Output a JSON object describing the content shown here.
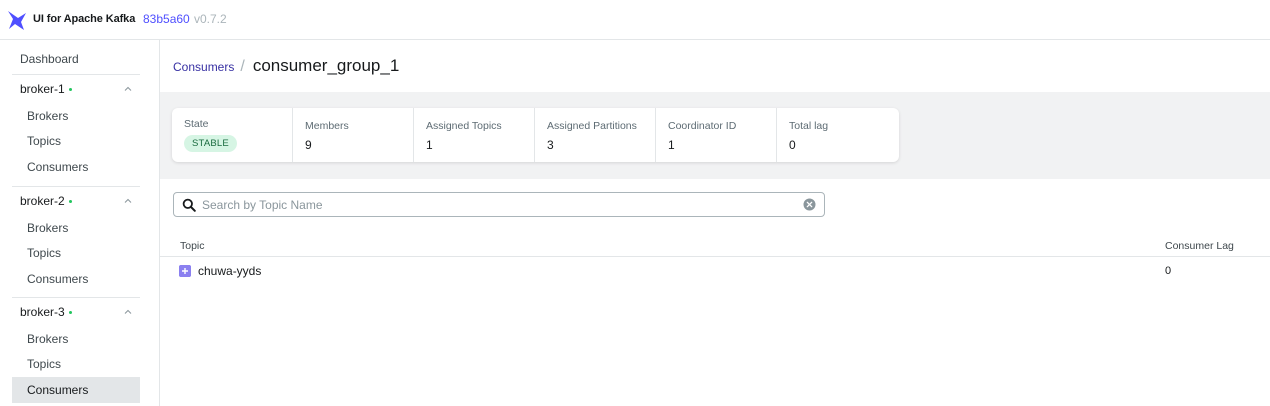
{
  "header": {
    "app_title": "UI for Apache Kafka",
    "version_hash": "83b5a60",
    "version": "v0.7.2",
    "brand_color": "#4f4fff"
  },
  "sidebar": {
    "dashboard_label": "Dashboard",
    "groups": [
      {
        "name": "broker-1",
        "status_color": "#22c55e",
        "items": [
          {
            "label": "Brokers"
          },
          {
            "label": "Topics"
          },
          {
            "label": "Consumers"
          }
        ]
      },
      {
        "name": "broker-2",
        "status_color": "#22c55e",
        "items": [
          {
            "label": "Brokers"
          },
          {
            "label": "Topics"
          },
          {
            "label": "Consumers"
          }
        ]
      },
      {
        "name": "broker-3",
        "status_color": "#22c55e",
        "items": [
          {
            "label": "Brokers"
          },
          {
            "label": "Topics"
          },
          {
            "label": "Consumers",
            "active": true
          }
        ]
      }
    ]
  },
  "breadcrumb": {
    "parent": "Consumers",
    "separator": "/",
    "current": "consumer_group_1"
  },
  "metrics": {
    "state": {
      "label": "State",
      "value": "STABLE"
    },
    "members": {
      "label": "Members",
      "value": "9"
    },
    "assigned_topics": {
      "label": "Assigned Topics",
      "value": "1"
    },
    "assigned_partitions": {
      "label": "Assigned Partitions",
      "value": "3"
    },
    "coordinator_id": {
      "label": "Coordinator ID",
      "value": "1"
    },
    "total_lag": {
      "label": "Total lag",
      "value": "0"
    }
  },
  "search": {
    "placeholder": "Search by Topic Name",
    "value": ""
  },
  "table": {
    "columns": {
      "topic": "Topic",
      "consumer_lag": "Consumer Lag"
    },
    "rows": [
      {
        "topic": "chuwa-yyds",
        "consumer_lag": "0"
      }
    ]
  },
  "icons": {
    "logo": "kafka-ui-logo-icon",
    "collapse": "chevron-up-icon",
    "search": "search-icon",
    "clear": "clear-circle-x-icon",
    "expand": "plus-square-icon"
  }
}
